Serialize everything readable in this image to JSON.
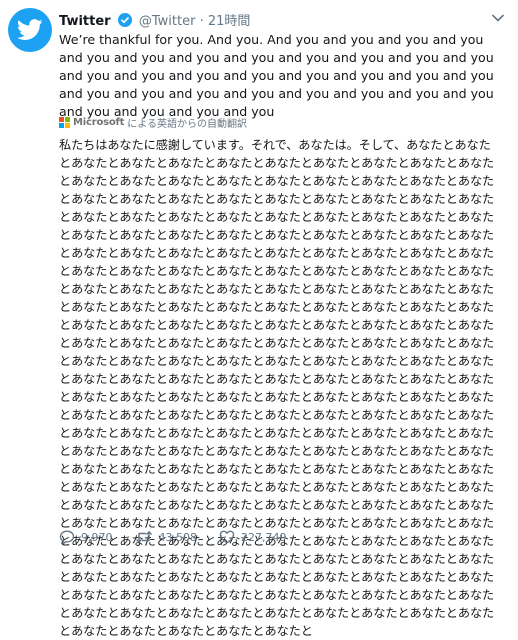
{
  "author": {
    "name": "Twitter",
    "handle": "@Twitter",
    "separator": "·",
    "time": "21時間"
  },
  "tweet": {
    "text_en": "We’re thankful for you. And you. And you and you and you and you and you and you and you and you and you and you and you and you and you and you and you and you and you and you and you and you and you and you and you and you and you and you and you and you and you and you and you and you",
    "translation_label": "による英語からの自動翻訳",
    "translation_provider": "Microsoft",
    "text_ja": "私たちはあなたに感謝しています。それで、あなたは。そして、あなたとあなたとあなたとあなたとあなたとあなたとあなたとあなたとあなたとあなたとあなたとあなたとあなたとあなたとあなたとあなたとあなたとあなたとあなたとあなたとあなたとあなたとあなたとあなたとあなたとあなたとあなたとあなたとあなたとあなたとあなたとあなたとあなたとあなたとあなたとあなたとあなたとあなたとあなたとあなたとあなたとあなたとあなたとあなたとあなたとあなたとあなたとあなたとあなたとあなたとあなたとあなたとあなたとあなたとあなたとあなたとあなたとあなたとあなたとあなたとあなたとあなたとあなたとあなたとあなたとあなたとあなたとあなたとあなたとあなたとあなたとあなたとあなたとあなたとあなたとあなたとあなたとあなたとあなたとあなたとあなたとあなたとあなたとあなたとあなたとあなたとあなたとあなたとあなたとあなたとあなたとあなたとあなたとあなたとあなたとあなたとあなたとあなたとあなたとあなたとあなたとあなたとあなたとあなたとあなたとあなたとあなたとあなたとあなたとあなたとあなたとあなたとあなたとあなたとあなたとあなたとあなたとあなたとあなたとあなたとあなたとあなたとあなたとあなたとあなたとあなたとあなたとあなたとあなたとあなたとあなたとあなたとあなたとあなたとあなたとあなたとあなたとあなたとあなたとあなたとあなたとあなたとあなたとあなたとあなたとあなたとあなたとあなたとあなたとあなたとあなたとあなたとあなたとあなたとあなたとあなたとあなたとあなたとあなたとあなたとあなたとあなたとあなたとあなたとあなたとあなたとあなたとあなたとあなたとあなたとあなたとあなたとあなたとあなたとあなたとあなたとあなたとあなたとあなたとあなたとあなたとあなたとあなたとあなたとあなたとあなたとあなたとあなたとあなたとあなたとあなたとあなたとあなたとあなたとあなたとあなたとあなたとあなたとあなたとあなたとあなたとあなたとあなたとあなたとあなたとあなたとあなたとあなたとあなたとあなたとあなたとあなたとあなたとあなたとあなたとあなたとあなたとあなたとあなたとあなたとあなたとあなたとあなたとあなたとあなたとあなたとあなたとあなたとあなたとあなたとあなたとあなたとあなたとあなたとあなたとあなたとあなたとあなたとあなたとあなたとあなたと"
  },
  "stats": {
    "replies": "9,970",
    "retweets": "43,508",
    "likes": "227,749"
  },
  "icons": {
    "avatar": "twitter-bird-icon",
    "verified": "verified-badge-icon",
    "caret": "chevron-down-icon",
    "reply": "reply-icon",
    "retweet": "retweet-icon",
    "like": "heart-icon"
  },
  "colors": {
    "brand": "#1da1f2",
    "text": "#14171a",
    "muted": "#657786"
  }
}
